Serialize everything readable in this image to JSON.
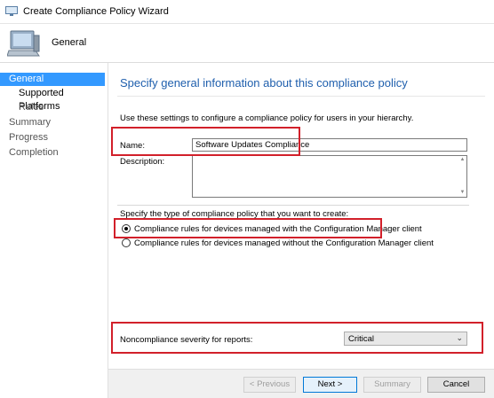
{
  "window": {
    "title": "Create Compliance Policy Wizard"
  },
  "header": {
    "page_name": "General"
  },
  "nav": {
    "items": [
      {
        "label": "General"
      },
      {
        "label": "Supported Platforms"
      },
      {
        "label": "Rules"
      },
      {
        "label": "Summary"
      },
      {
        "label": "Progress"
      },
      {
        "label": "Completion"
      }
    ]
  },
  "main": {
    "heading": "Specify general information about this compliance policy",
    "description": "Use these settings to configure a compliance policy for users in your hierarchy.",
    "name_label": "Name:",
    "name_value": "Software Updates Compliance",
    "description_label": "Description:",
    "description_value": "",
    "policy_type_label": "Specify the type of compliance policy that you want to create:",
    "radio_managed": "Compliance rules for devices managed with the Configuration Manager client",
    "radio_unmanaged": "Compliance rules for devices managed without the Configuration Manager client",
    "selected_radio": "managed",
    "severity_label": "Noncompliance severity for reports:",
    "severity_value": "Critical"
  },
  "footer": {
    "previous_label": "< Previous",
    "next_label": "Next >",
    "summary_label": "Summary",
    "cancel_label": "Cancel"
  },
  "colors": {
    "accent": "#3399ff",
    "heading": "#1f5fad",
    "highlight": "#d2202a"
  }
}
